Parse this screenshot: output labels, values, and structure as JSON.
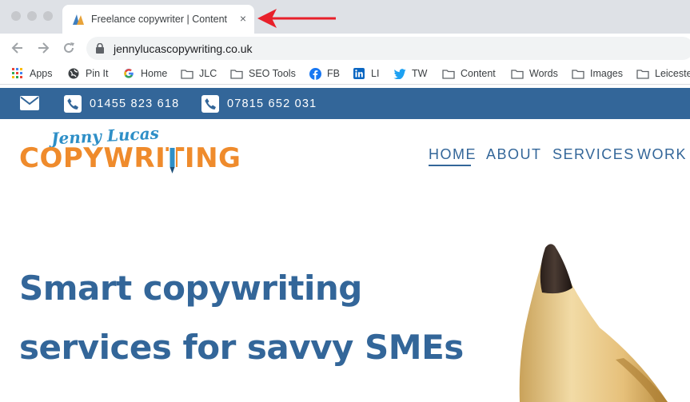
{
  "browser": {
    "tab": {
      "title": "Freelance copywriter | Content",
      "close_glyph": "×"
    },
    "address_bar": {
      "url": "jennylucascopywriting.co.uk"
    },
    "bookmarks": [
      {
        "label": "Apps",
        "icon": "apps-grid-icon"
      },
      {
        "label": "Pin It",
        "icon": "globe-icon"
      },
      {
        "label": "Home",
        "icon": "google-icon"
      },
      {
        "label": "JLC",
        "icon": "folder-icon"
      },
      {
        "label": "SEO Tools",
        "icon": "folder-icon"
      },
      {
        "label": "FB",
        "icon": "facebook-icon"
      },
      {
        "label": "LI",
        "icon": "linkedin-icon"
      },
      {
        "label": "TW",
        "icon": "twitter-icon"
      },
      {
        "label": "Content",
        "icon": "folder-icon"
      },
      {
        "label": "Words",
        "icon": "folder-icon"
      },
      {
        "label": "Images",
        "icon": "folder-icon"
      },
      {
        "label": "Leicester",
        "icon": "folder-icon"
      }
    ],
    "annotation_arrow_color": "#e8202a"
  },
  "site": {
    "colors": {
      "brand_blue": "#336699",
      "logo_orange": "#ef8b2c",
      "logo_script_blue": "#2e8fc7"
    },
    "contact_bar": {
      "phone_1": "01455 823 618",
      "phone_2": "07815 652 031"
    },
    "logo": {
      "script_text": "Jenny Lucas",
      "main_text": "COPYWRITING"
    },
    "nav": {
      "items": [
        "HOME",
        "ABOUT",
        "SERVICES",
        "WORK"
      ],
      "active": "HOME"
    },
    "hero": {
      "line_1": "Smart copywriting",
      "line_2": "services for savvy SMEs"
    }
  }
}
